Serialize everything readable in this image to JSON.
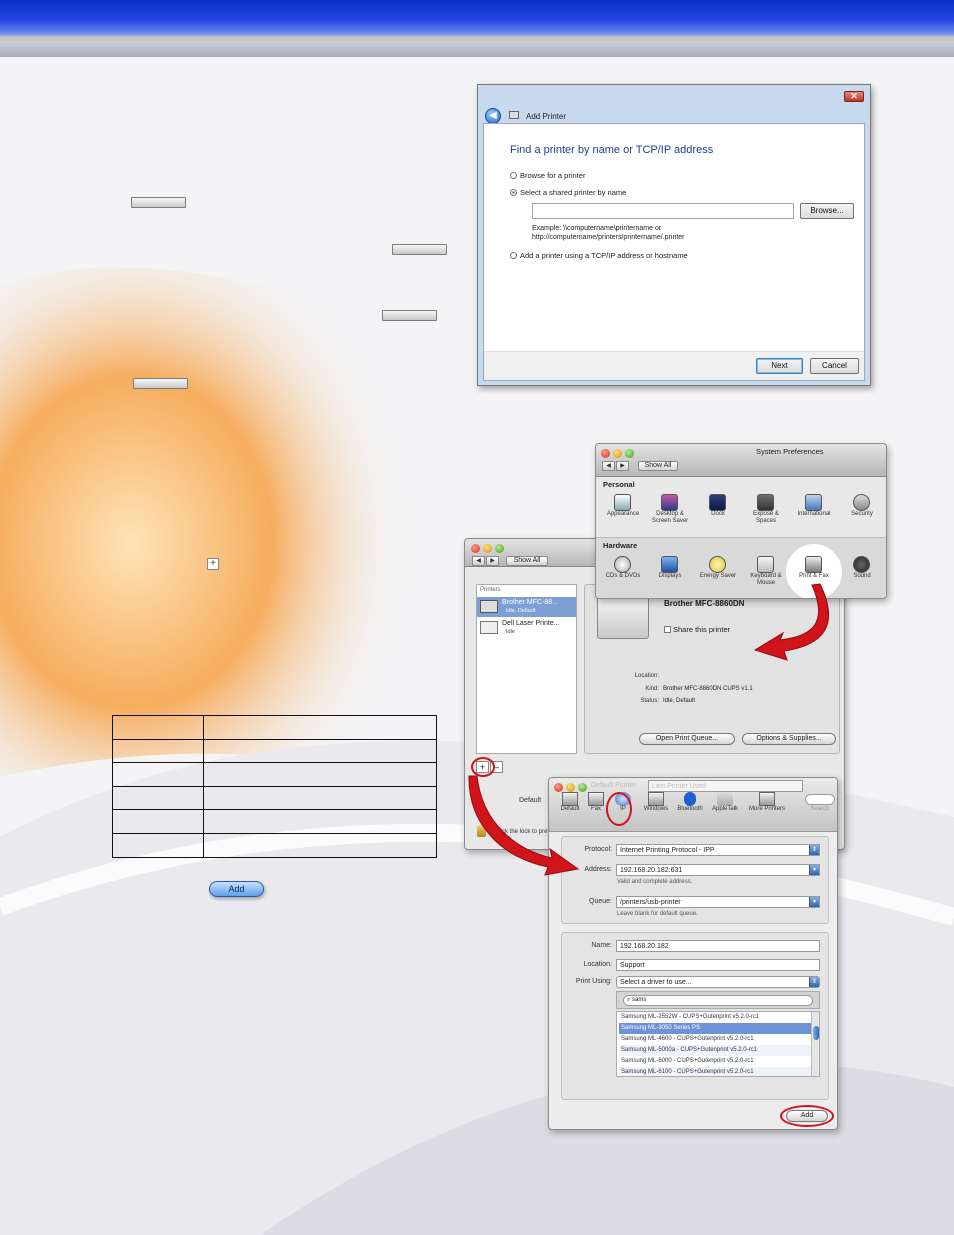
{
  "colors": {
    "header_blue": "#1a3fd8",
    "swoosh_orange": "#f39a42",
    "arrow_red": "#d0141a",
    "selection_blue": "#7d9fd4"
  },
  "win_dialog": {
    "title": "Add Printer",
    "heading": "Find a printer by name or TCP/IP address",
    "option_browse": "Browse for a printer",
    "option_shared": "Select a shared printer by name",
    "browse_button": "Browse...",
    "example_line1": "Example: \\\\computername\\printername or",
    "example_line2": "http://computername/printers/printername/.printer",
    "option_tcpip": "Add a printer using a TCP/IP address or hostname",
    "next_button": "Next",
    "cancel_button": "Cancel",
    "icons": {
      "close": "close-icon",
      "back": "back-arrow-icon",
      "printer": "printer-icon"
    }
  },
  "add_pill_label": "Add",
  "plus_symbol": "+",
  "sys_prefs": {
    "title": "System Preferences",
    "show_all": "Show All",
    "personal_label": "Personal",
    "personal_items": [
      "Appearance",
      "Desktop & Screen Saver",
      "Dock",
      "Exposé & Spaces",
      "International",
      "Security"
    ],
    "hardware_label": "Hardware",
    "hardware_items": [
      "CDs & DVDs",
      "Displays",
      "Energy Saver",
      "Keyboard & Mouse",
      "Print & Fax",
      "Sound"
    ]
  },
  "print_fax": {
    "show_all": "Show All",
    "printers_label": "Printers",
    "printer1_name": "Brother MFC-88...",
    "printer1_status": "Idle, Default",
    "printer2_name": "Dell Laser Printe...",
    "printer2_status": "Idle",
    "selected_name": "Brother MFC-8860DN",
    "share_label": "Share this printer",
    "location_label": "Location:",
    "kind_label": "Kind:",
    "kind_value": "Brother MFC-8860DN CUPS v1.1",
    "status_label": "Status:",
    "status_value": "Idle, Default",
    "open_queue": "Open Print Queue...",
    "options_supplies": "Options & Supplies...",
    "default_label": "Default",
    "lock_text": "Click the lock to prevent further changes.",
    "add_symbol": "+",
    "remove_symbol": "–"
  },
  "add_dialog": {
    "default_printer_label": "Default Printer:",
    "default_printer_value": "Last Printer Used",
    "toolbar": [
      "Default",
      "Fax",
      "IP",
      "Windows",
      "Bluetooth",
      "AppleTalk",
      "More Printers"
    ],
    "search_label": "Search",
    "protocol_label": "Protocol:",
    "protocol_value": "Internet Printing Protocol - IPP",
    "address_label": "Address:",
    "address_value": "192.168.20.182:631",
    "address_hint": "Valid and complete address.",
    "queue_label": "Queue:",
    "queue_value": "/printers/usb-printer",
    "queue_hint": "Leave blank for default queue.",
    "name_label": "Name:",
    "name_value": "192.168.20.182",
    "location_label": "Location:",
    "location_value": "Support",
    "print_using_label": "Print Using:",
    "print_using_value": "Select a driver to use...",
    "driver_search": "sams",
    "drivers": [
      "Samsung ML-2552W - CUPS+Gutenprint v5.2.0-rc1",
      "Samsung ML-3050 Series PS",
      "Samsung ML-4600 - CUPS+Gutenprint v5.2.0-rc1",
      "Samsung ML-5000a - CUPS+Gutenprint v5.2.0-rc1",
      "Samsung ML-6000 - CUPS+Gutenprint v5.2.0-rc1",
      "Samsung ML-6100 - CUPS+Gutenprint v5.2.0-rc1"
    ],
    "add_button": "Add"
  }
}
